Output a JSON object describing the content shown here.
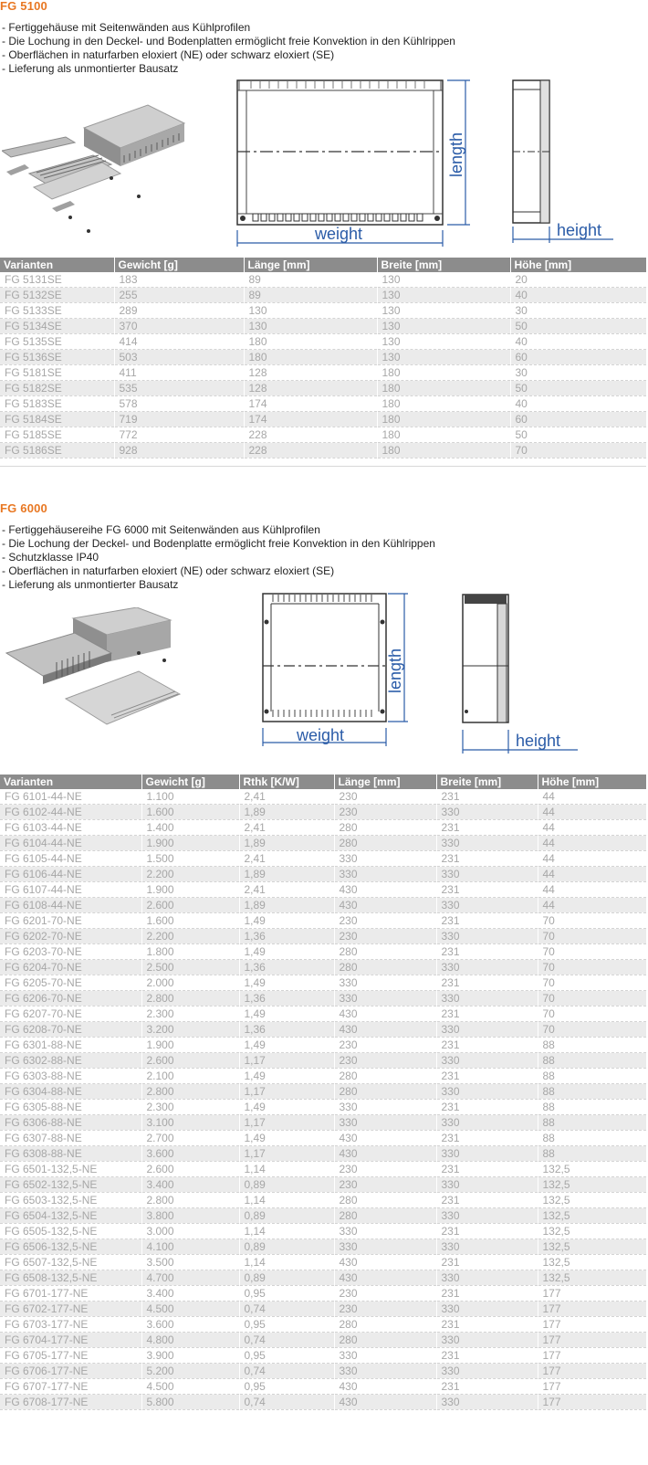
{
  "fg5100": {
    "title": "FG 5100",
    "bullets": [
      "- Fertiggehäuse mit Seitenwänden aus Kühlprofilen",
      "- Die Lochung in den Deckel- und Bodenplatten ermöglicht freie Konvektion in den Kühlrippen",
      "- Oberflächen in naturfarben eloxiert (NE) oder schwarz eloxiert (SE)",
      "- Lieferung als unmontierter Bausatz"
    ],
    "drawing_labels": {
      "length": "length",
      "weight": "weight",
      "height": "height"
    },
    "columns": [
      "Varianten",
      "Gewicht [g]",
      "Länge [mm]",
      "Breite [mm]",
      "Höhe [mm]"
    ],
    "rows": [
      [
        "FG 5131SE",
        "183",
        "89",
        "130",
        "20"
      ],
      [
        "FG 5132SE",
        "255",
        "89",
        "130",
        "40"
      ],
      [
        "FG 5133SE",
        "289",
        "130",
        "130",
        "30"
      ],
      [
        "FG 5134SE",
        "370",
        "130",
        "130",
        "50"
      ],
      [
        "FG 5135SE",
        "414",
        "180",
        "130",
        "40"
      ],
      [
        "FG 5136SE",
        "503",
        "180",
        "130",
        "60"
      ],
      [
        "FG 5181SE",
        "411",
        "128",
        "180",
        "30"
      ],
      [
        "FG 5182SE",
        "535",
        "128",
        "180",
        "50"
      ],
      [
        "FG 5183SE",
        "578",
        "174",
        "180",
        "40"
      ],
      [
        "FG 5184SE",
        "719",
        "174",
        "180",
        "60"
      ],
      [
        "FG 5185SE",
        "772",
        "228",
        "180",
        "50"
      ],
      [
        "FG 5186SE",
        "928",
        "228",
        "180",
        "70"
      ]
    ]
  },
  "fg6000": {
    "title": "FG 6000",
    "bullets": [
      "- Fertiggehäusereihe FG 6000 mit Seitenwänden aus Kühlprofilen",
      "- Die Lochung der Deckel- und Bodenplatte ermöglicht freie Konvektion in den Kühlrippen",
      "- Schutzklasse IP40",
      "- Oberflächen in naturfarben eloxiert (NE) oder schwarz eloxiert (SE)",
      "- Lieferung als unmontierter Bausatz"
    ],
    "drawing_labels": {
      "length": "length",
      "weight": "weight",
      "height": "height"
    },
    "columns": [
      "Varianten",
      "Gewicht [g]",
      "Rthk [K/W]",
      "Länge [mm]",
      "Breite [mm]",
      "Höhe [mm]"
    ],
    "rows": [
      [
        "FG 6101-44-NE",
        "1.100",
        "2,41",
        "230",
        "231",
        "44"
      ],
      [
        "FG 6102-44-NE",
        "1.600",
        "1,89",
        "230",
        "330",
        "44"
      ],
      [
        "FG 6103-44-NE",
        "1.400",
        "2,41",
        "280",
        "231",
        "44"
      ],
      [
        "FG 6104-44-NE",
        "1.900",
        "1,89",
        "280",
        "330",
        "44"
      ],
      [
        "FG 6105-44-NE",
        "1.500",
        "2,41",
        "330",
        "231",
        "44"
      ],
      [
        "FG 6106-44-NE",
        "2.200",
        "1,89",
        "330",
        "330",
        "44"
      ],
      [
        "FG 6107-44-NE",
        "1.900",
        "2,41",
        "430",
        "231",
        "44"
      ],
      [
        "FG 6108-44-NE",
        "2.600",
        "1,89",
        "430",
        "330",
        "44"
      ],
      [
        "FG 6201-70-NE",
        "1.600",
        "1,49",
        "230",
        "231",
        "70"
      ],
      [
        "FG 6202-70-NE",
        "2.200",
        "1,36",
        "230",
        "330",
        "70"
      ],
      [
        "FG 6203-70-NE",
        "1.800",
        "1,49",
        "280",
        "231",
        "70"
      ],
      [
        "FG 6204-70-NE",
        "2.500",
        "1,36",
        "280",
        "330",
        "70"
      ],
      [
        "FG 6205-70-NE",
        "2.000",
        "1,49",
        "330",
        "231",
        "70"
      ],
      [
        "FG 6206-70-NE",
        "2.800",
        "1,36",
        "330",
        "330",
        "70"
      ],
      [
        "FG 6207-70-NE",
        "2.300",
        "1,49",
        "430",
        "231",
        "70"
      ],
      [
        "FG 6208-70-NE",
        "3.200",
        "1,36",
        "430",
        "330",
        "70"
      ],
      [
        "FG 6301-88-NE",
        "1.900",
        "1,49",
        "230",
        "231",
        "88"
      ],
      [
        "FG 6302-88-NE",
        "2.600",
        "1,17",
        "230",
        "330",
        "88"
      ],
      [
        "FG 6303-88-NE",
        "2.100",
        "1,49",
        "280",
        "231",
        "88"
      ],
      [
        "FG 6304-88-NE",
        "2.800",
        "1,17",
        "280",
        "330",
        "88"
      ],
      [
        "FG 6305-88-NE",
        "2.300",
        "1,49",
        "330",
        "231",
        "88"
      ],
      [
        "FG 6306-88-NE",
        "3.100",
        "1,17",
        "330",
        "330",
        "88"
      ],
      [
        "FG 6307-88-NE",
        "2.700",
        "1,49",
        "430",
        "231",
        "88"
      ],
      [
        "FG 6308-88-NE",
        "3.600",
        "1,17",
        "430",
        "330",
        "88"
      ],
      [
        "FG 6501-132,5-NE",
        "2.600",
        "1,14",
        "230",
        "231",
        "132,5"
      ],
      [
        "FG 6502-132,5-NE",
        "3.400",
        "0,89",
        "230",
        "330",
        "132,5"
      ],
      [
        "FG 6503-132,5-NE",
        "2.800",
        "1,14",
        "280",
        "231",
        "132,5"
      ],
      [
        "FG 6504-132,5-NE",
        "3.800",
        "0,89",
        "280",
        "330",
        "132,5"
      ],
      [
        "FG 6505-132,5-NE",
        "3.000",
        "1,14",
        "330",
        "231",
        "132,5"
      ],
      [
        "FG 6506-132,5-NE",
        "4.100",
        "0,89",
        "330",
        "330",
        "132,5"
      ],
      [
        "FG 6507-132,5-NE",
        "3.500",
        "1,14",
        "430",
        "231",
        "132,5"
      ],
      [
        "FG 6508-132,5-NE",
        "4.700",
        "0,89",
        "430",
        "330",
        "132,5"
      ],
      [
        "FG 6701-177-NE",
        "3.400",
        "0,95",
        "230",
        "231",
        "177"
      ],
      [
        "FG 6702-177-NE",
        "4.500",
        "0,74",
        "230",
        "330",
        "177"
      ],
      [
        "FG 6703-177-NE",
        "3.600",
        "0,95",
        "280",
        "231",
        "177"
      ],
      [
        "FG 6704-177-NE",
        "4.800",
        "0,74",
        "280",
        "330",
        "177"
      ],
      [
        "FG 6705-177-NE",
        "3.900",
        "0,95",
        "330",
        "231",
        "177"
      ],
      [
        "FG 6706-177-NE",
        "5.200",
        "0,74",
        "330",
        "330",
        "177"
      ],
      [
        "FG 6707-177-NE",
        "4.500",
        "0,95",
        "430",
        "231",
        "177"
      ],
      [
        "FG 6708-177-NE",
        "5.800",
        "0,74",
        "430",
        "330",
        "177"
      ]
    ]
  }
}
